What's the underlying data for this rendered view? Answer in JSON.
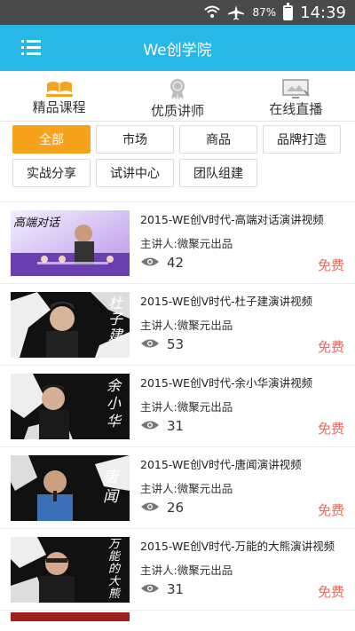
{
  "status": {
    "battery": "87%",
    "time": "14:39"
  },
  "app_bar": {
    "title": "We创学院"
  },
  "categories": [
    {
      "label": "精品课程",
      "icon": "books-icon"
    },
    {
      "label": "优质讲师",
      "icon": "medal-icon"
    },
    {
      "label": "在线直播",
      "icon": "live-screen-icon"
    }
  ],
  "filters": {
    "row1": [
      "全部",
      "市场",
      "商品",
      "品牌打造"
    ],
    "row2": [
      "实战分享",
      "试讲中心",
      "团队组建"
    ],
    "active": "全部"
  },
  "courses": [
    {
      "title": "2015-WE创V时代-高端对话演讲视频",
      "speaker": "主讲人:微聚元出品",
      "views": "42",
      "price": "免费",
      "thumb_text": "高端对话"
    },
    {
      "title": "2015-WE创V时代-杜子建演讲视频",
      "speaker": "主讲人:微聚元出品",
      "views": "53",
      "price": "免费",
      "thumb_text": "杜子建"
    },
    {
      "title": "2015-WE创V时代-余小华演讲视频",
      "speaker": "主讲人:微聚元出品",
      "views": "31",
      "price": "免费",
      "thumb_text": "余小华"
    },
    {
      "title": "2015-WE创V时代-唐闻演讲视频",
      "speaker": "主讲人:微聚元出品",
      "views": "26",
      "price": "免费",
      "thumb_text": "唐闻"
    },
    {
      "title": "2015-WE创V时代-万能的大熊演讲视频",
      "speaker": "主讲人:微聚元出品",
      "views": "31",
      "price": "免费",
      "thumb_text": "万能的大熊"
    }
  ],
  "colors": {
    "accent": "#28b8e8",
    "active_chip": "#f7a21b",
    "price": "#e86b5f"
  }
}
